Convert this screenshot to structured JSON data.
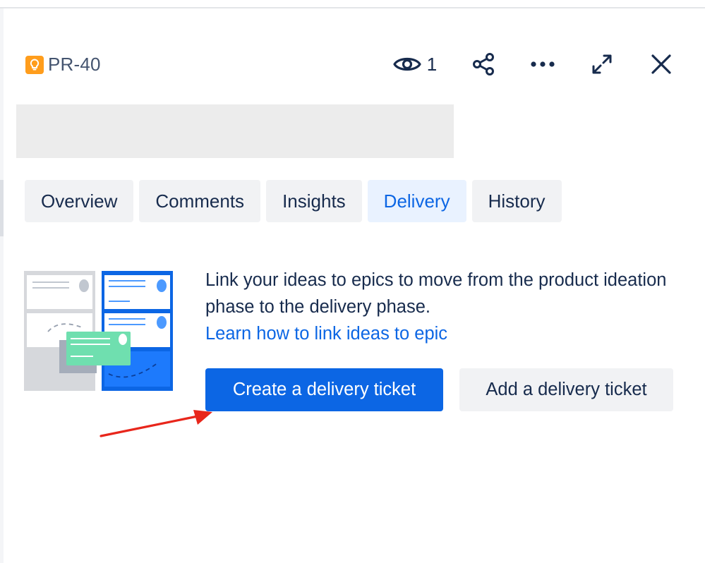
{
  "header": {
    "issue_key": "PR-40",
    "issue_type_icon": "lightbulb-icon",
    "watch_count": "1",
    "actions": [
      "eye-icon",
      "share-icon",
      "more-icon",
      "expand-icon",
      "close-icon"
    ]
  },
  "tabs": [
    {
      "label": "Overview",
      "active": false
    },
    {
      "label": "Comments",
      "active": false
    },
    {
      "label": "Insights",
      "active": false
    },
    {
      "label": "Delivery",
      "active": true
    },
    {
      "label": "History",
      "active": false
    }
  ],
  "delivery": {
    "description": "Link your ideas to epics to move from the product ideation phase to the delivery phase.",
    "learn_link": "Learn how to link ideas to epic",
    "create_button": "Create a delivery ticket",
    "add_button": "Add a delivery ticket"
  },
  "colors": {
    "primary": "#0c66e4",
    "tab_active_bg": "#e9f2ff",
    "neutral_bg": "#f1f2f4",
    "text": "#172b4d",
    "issue_icon": "#ff9d1c",
    "annotation_arrow": "#e8261b"
  }
}
